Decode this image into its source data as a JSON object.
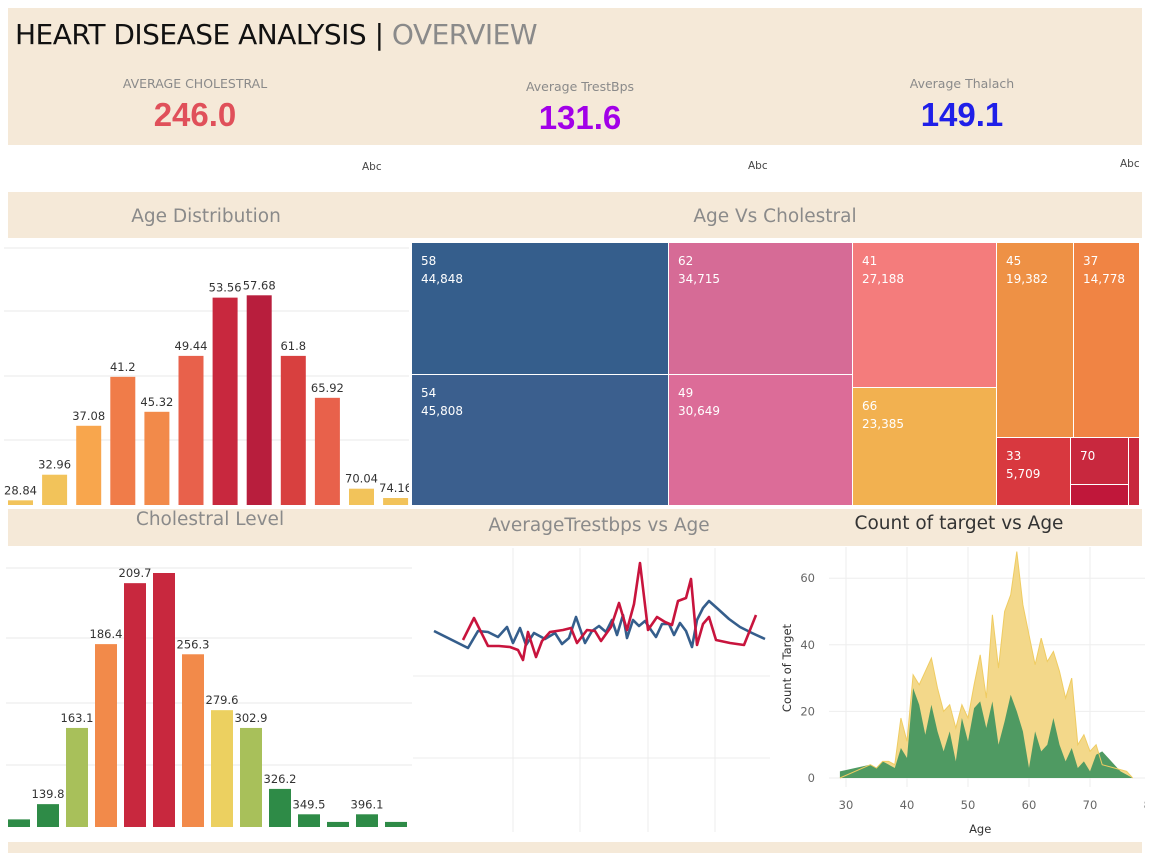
{
  "header": {
    "title": "HEART DISEASE ANALYSIS",
    "separator": " | ",
    "subtitle": "OVERVIEW"
  },
  "kpis": [
    {
      "label": "AVERAGE CHOLESTRAL",
      "value": "246.0",
      "color": "#e0505a"
    },
    {
      "label": "Average TrestBps",
      "value": "131.6",
      "color": "#a200e8"
    },
    {
      "label": "Average Thalach",
      "value": "149.1",
      "color": "#1f1fe8"
    }
  ],
  "placeholders": [
    "Abc",
    "Abc",
    "Abc"
  ],
  "sections": {
    "age_distribution": "Age Distribution",
    "age_vs_chol": "Age Vs Cholestral",
    "chol_level": "Cholestral Level",
    "trestbps_vs_age": "AverageTrestbps vs Age",
    "target_vs_age": "Count of target vs Age"
  },
  "chart_data": [
    {
      "type": "bar",
      "title": "Age Distribution",
      "labels": [
        "28.84",
        "32.96",
        "37.08",
        "41.2",
        "45.32",
        "49.44",
        "53.56",
        "57.68",
        "61.8",
        "65.92",
        "70.04",
        "74.16"
      ],
      "values": [
        2,
        13,
        34,
        55,
        40,
        64,
        89,
        90,
        64,
        46,
        7,
        3
      ],
      "colors": [
        "#f2c35a",
        "#f2c35a",
        "#f8a64d",
        "#f07c49",
        "#f28a4a",
        "#e8614b",
        "#c8283e",
        "#b81e3d",
        "#d8403f",
        "#e8614b",
        "#f2c35a",
        "#f2c35a"
      ]
    },
    {
      "type": "treemap",
      "title": "Age Vs Cholestral",
      "items": [
        {
          "age": "58",
          "value": "44,848",
          "color": "#355e8c"
        },
        {
          "age": "54",
          "value": "45,808",
          "color": "#3b5f8e"
        },
        {
          "age": "62",
          "value": "34,715",
          "color": "#d66b96"
        },
        {
          "age": "49",
          "value": "30,649",
          "color": "#dc6c98"
        },
        {
          "age": "41",
          "value": "27,188",
          "color": "#f47c7c"
        },
        {
          "age": "66",
          "value": "23,385",
          "color": "#f2b150"
        },
        {
          "age": "45",
          "value": "19,382",
          "color": "#ee9145"
        },
        {
          "age": "37",
          "value": "14,778",
          "color": "#f08444"
        },
        {
          "age": "33",
          "value": "5,709",
          "color": "#d8383f"
        },
        {
          "age": "70",
          "value": "",
          "color": "#c8283e"
        }
      ]
    },
    {
      "type": "bar",
      "title": "Cholestral Level",
      "labels": [
        "",
        "139.8",
        "163.1",
        "186.4",
        "209.7",
        "",
        "256.3",
        "279.6",
        "302.9",
        "326.2",
        "349.5",
        "",
        "396.1",
        ""
      ],
      "values": [
        3,
        9,
        39,
        72,
        96,
        100,
        68,
        46,
        39,
        15,
        5,
        2,
        5,
        2
      ],
      "colors": [
        "#2e8b47",
        "#2e8b47",
        "#a8c05a",
        "#f28a4a",
        "#c8283e",
        "#c8283e",
        "#f28a4a",
        "#ecd060",
        "#a8c05a",
        "#2e8b47",
        "#2e8b47",
        "#2e8b47",
        "#2e8b47",
        "#2e8b47"
      ]
    },
    {
      "type": "line",
      "title": "AverageTrestbps vs Age",
      "series": [
        {
          "color": "#355e8c",
          "values": [
            [
              434,
              631
            ],
            [
              468,
              648
            ],
            [
              478,
              631
            ],
            [
              488,
              632
            ],
            [
              498,
              637
            ],
            [
              507,
              627
            ],
            [
              513,
              643
            ],
            [
              520,
              628
            ],
            [
              526,
              645
            ],
            [
              534,
              633
            ],
            [
              545,
              639
            ],
            [
              555,
              633
            ],
            [
              562,
              644
            ],
            [
              569,
              638
            ],
            [
              576,
              617
            ],
            [
              585,
              643
            ],
            [
              592,
              631
            ],
            [
              599,
              626
            ],
            [
              606,
              632
            ],
            [
              612,
              620
            ],
            [
              617,
              635
            ],
            [
              623,
              615
            ],
            [
              627,
              638
            ],
            [
              633,
              620
            ],
            [
              639,
              626
            ],
            [
              645,
              621
            ],
            [
              651,
              630
            ],
            [
              656,
              637
            ],
            [
              662,
              624
            ],
            [
              669,
              624
            ],
            [
              674,
              635
            ],
            [
              680,
              623
            ],
            [
              686,
              631
            ],
            [
              692,
              647
            ],
            [
              697,
              620
            ],
            [
              703,
              608
            ],
            [
              709,
              601
            ],
            [
              718,
              609
            ],
            [
              729,
              619
            ],
            [
              740,
              627
            ],
            [
              752,
              633
            ],
            [
              765,
              639
            ]
          ]
        },
        {
          "color": "#c8143d",
          "values": [
            [
              463,
              640
            ],
            [
              474,
              618
            ],
            [
              488,
              646
            ],
            [
              499,
              646
            ],
            [
              510,
              647
            ],
            [
              518,
              650
            ],
            [
              523,
              660
            ],
            [
              528,
              632
            ],
            [
              536,
              657
            ],
            [
              542,
              641
            ],
            [
              550,
              632
            ],
            [
              563,
              630
            ],
            [
              571,
              628
            ],
            [
              577,
              643
            ],
            [
              587,
              630
            ],
            [
              595,
              631
            ],
            [
              601,
              641
            ],
            [
              611,
              627
            ],
            [
              619,
              603
            ],
            [
              627,
              630
            ],
            [
              634,
              604
            ],
            [
              640,
              563
            ],
            [
              648,
              630
            ],
            [
              657,
              617
            ],
            [
              665,
              622
            ],
            [
              672,
              625
            ],
            [
              678,
              601
            ],
            [
              686,
              598
            ],
            [
              691,
              579
            ],
            [
              697,
              645
            ],
            [
              703,
              624
            ],
            [
              709,
              617
            ],
            [
              716,
              640
            ],
            [
              730,
              643
            ],
            [
              744,
              645
            ],
            [
              756,
              615
            ]
          ]
        }
      ]
    },
    {
      "type": "area",
      "title": "Count of target vs Age",
      "xlabel": "Age",
      "ylabel": "Count of Target",
      "xticks": [
        30,
        40,
        50,
        60,
        70,
        80
      ],
      "yticks": [
        0,
        20,
        40,
        60
      ],
      "series": [
        {
          "color": "#f3d88a",
          "values": [
            [
              29,
              0
            ],
            [
              34,
              4
            ],
            [
              35,
              3
            ],
            [
              36,
              5
            ],
            [
              37,
              5
            ],
            [
              38,
              4
            ],
            [
              39,
              18
            ],
            [
              40,
              11
            ],
            [
              41,
              31
            ],
            [
              42,
              28
            ],
            [
              43,
              32
            ],
            [
              44,
              36
            ],
            [
              45,
              27
            ],
            [
              46,
              20
            ],
            [
              47,
              22
            ],
            [
              48,
              15
            ],
            [
              49,
              22
            ],
            [
              50,
              18
            ],
            [
              51,
              28
            ],
            [
              52,
              37
            ],
            [
              53,
              24
            ],
            [
              54,
              49
            ],
            [
              55,
              33
            ],
            [
              56,
              50
            ],
            [
              57,
              55
            ],
            [
              58,
              68
            ],
            [
              59,
              52
            ],
            [
              60,
              43
            ],
            [
              61,
              34
            ],
            [
              62,
              42
            ],
            [
              63,
              35
            ],
            [
              64,
              38
            ],
            [
              65,
              32
            ],
            [
              66,
              24
            ],
            [
              67,
              30
            ],
            [
              68,
              10
            ],
            [
              69,
              13
            ],
            [
              70,
              8
            ],
            [
              71,
              10
            ],
            [
              72,
              4
            ],
            [
              74,
              3
            ],
            [
              76,
              2
            ],
            [
              77,
              0
            ]
          ]
        },
        {
          "color": "#4f9a62",
          "values": [
            [
              29,
              2
            ],
            [
              34,
              4
            ],
            [
              35,
              3
            ],
            [
              36,
              5
            ],
            [
              37,
              4
            ],
            [
              38,
              3
            ],
            [
              39,
              9
            ],
            [
              40,
              6
            ],
            [
              41,
              27
            ],
            [
              42,
              22
            ],
            [
              43,
              13
            ],
            [
              44,
              22
            ],
            [
              45,
              14
            ],
            [
              46,
              8
            ],
            [
              47,
              14
            ],
            [
              48,
              5
            ],
            [
              49,
              18
            ],
            [
              50,
              11
            ],
            [
              51,
              21
            ],
            [
              52,
              23
            ],
            [
              53,
              15
            ],
            [
              54,
              23
            ],
            [
              55,
              10
            ],
            [
              56,
              17
            ],
            [
              57,
              25
            ],
            [
              58,
              20
            ],
            [
              59,
              14
            ],
            [
              60,
              3
            ],
            [
              61,
              14
            ],
            [
              62,
              8
            ],
            [
              63,
              10
            ],
            [
              64,
              18
            ],
            [
              65,
              10
            ],
            [
              66,
              5
            ],
            [
              67,
              9
            ],
            [
              68,
              3
            ],
            [
              69,
              5
            ],
            [
              70,
              2
            ],
            [
              71,
              7
            ],
            [
              72,
              8
            ],
            [
              73,
              6
            ],
            [
              75,
              2
            ],
            [
              77,
              0
            ]
          ]
        }
      ]
    }
  ]
}
